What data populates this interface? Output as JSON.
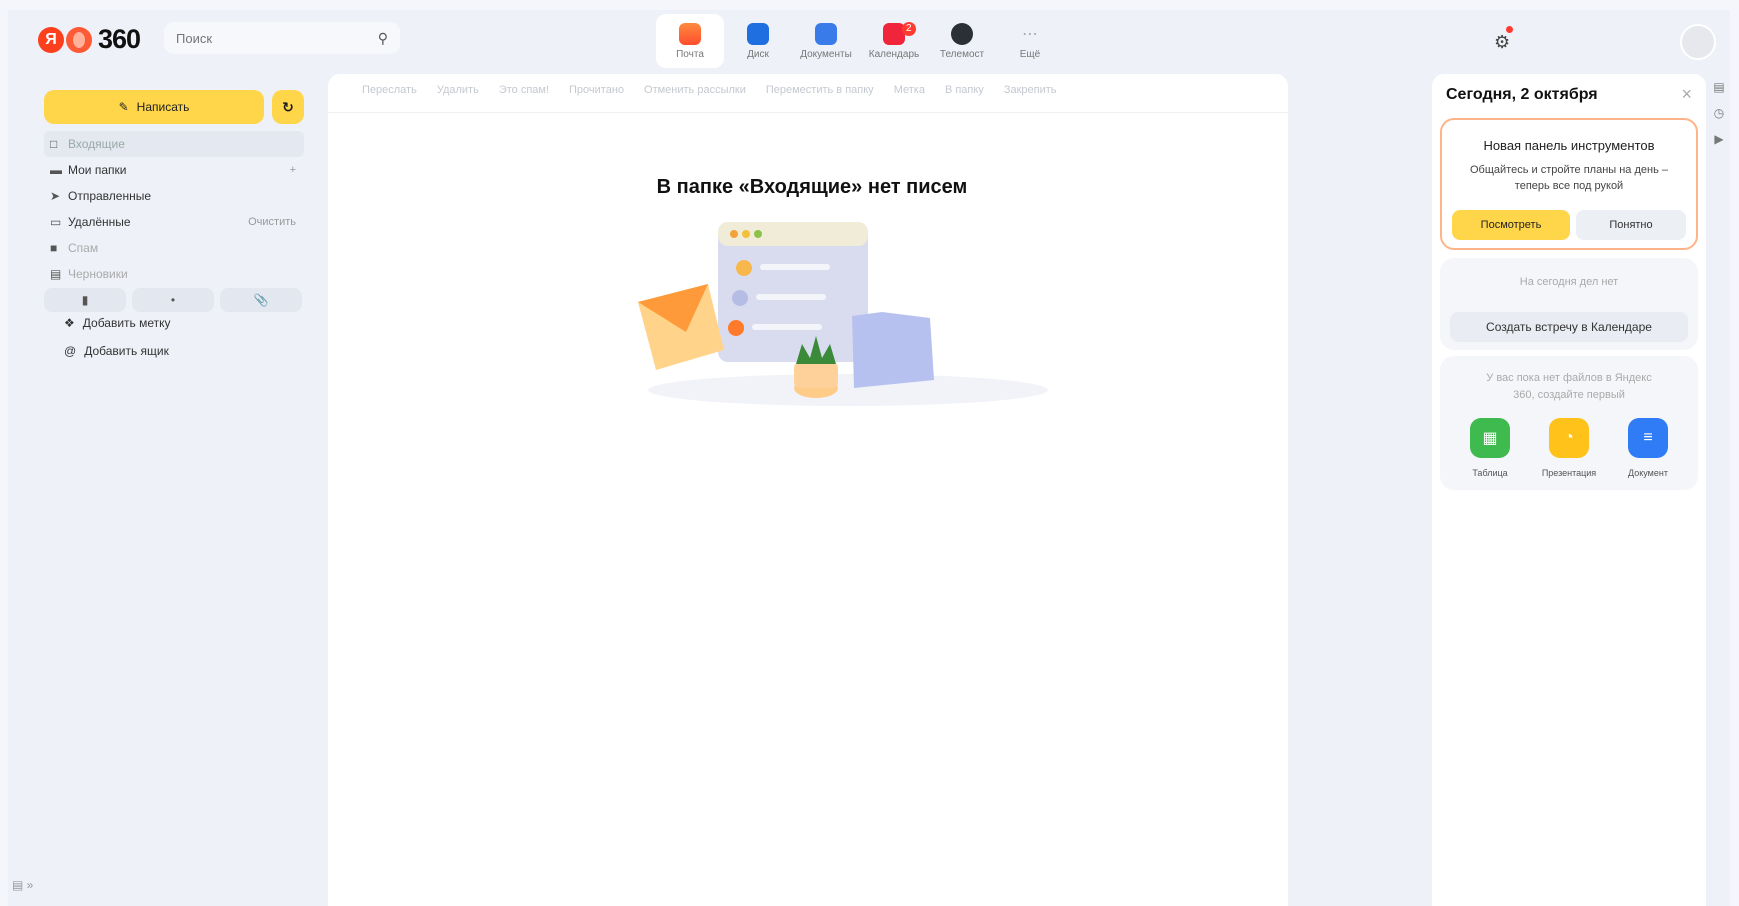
{
  "header": {
    "logo_number": "360",
    "search_placeholder": "Поиск",
    "services": [
      {
        "label": "Почта",
        "color": "#ff6b2b"
      },
      {
        "label": "Диск",
        "color": "#1f6fe0"
      },
      {
        "label": "Документы",
        "color": "#3a7bea"
      },
      {
        "label": "Календарь",
        "color": "#f0243a",
        "badge": "2"
      },
      {
        "label": "Телемост",
        "color": "#2b2f36"
      },
      {
        "label": "Ещё"
      }
    ]
  },
  "sidebar": {
    "compose_label": "Написать",
    "folders": [
      {
        "label": "Входящие"
      },
      {
        "label": "Мои папки",
        "action": "+"
      },
      {
        "label": "Отправленные"
      },
      {
        "label": "Удалённые",
        "action": "Очистить"
      },
      {
        "label": "Спам"
      },
      {
        "label": "Черновики"
      }
    ],
    "add_label": "Добавить метку",
    "add_mailbox": "Добавить ящик"
  },
  "toolbar": [
    "Переслать",
    "Удалить",
    "Это спам!",
    "Прочитано",
    "Отменить рассылки",
    "Переместить в папку",
    "Метка",
    "В папку",
    "Закрепить"
  ],
  "main": {
    "empty_title": "В папке «Входящие» нет писем"
  },
  "rpanel": {
    "title": "Сегодня, 2 октября",
    "promo_title": "Новая панель инструментов",
    "promo_text": "Общайтесь и стройте планы на день – теперь все под рукой",
    "btn_view": "Посмотреть",
    "btn_ok": "Понятно",
    "no_events": "На сегодня дел нет",
    "create_meeting": "Создать встречу в Календаре",
    "no_files": "У вас пока нет файлов в Яндекс 360, создайте первый",
    "docs": [
      {
        "label": "Таблица",
        "color": "#3fba4e"
      },
      {
        "label": "Презентация",
        "color": "#ffc21a"
      },
      {
        "label": "Документ",
        "color": "#2f7cf6"
      }
    ]
  },
  "colors": {
    "accent": "#ffd64a",
    "promo_border": "#ffb48a"
  }
}
